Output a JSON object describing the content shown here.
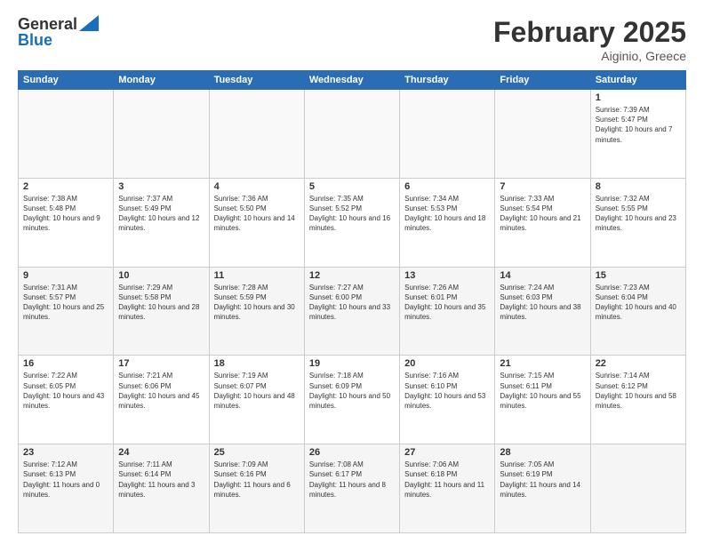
{
  "header": {
    "logo_general": "General",
    "logo_blue": "Blue",
    "month_title": "February 2025",
    "subtitle": "Aiginio, Greece"
  },
  "days_of_week": [
    "Sunday",
    "Monday",
    "Tuesday",
    "Wednesday",
    "Thursday",
    "Friday",
    "Saturday"
  ],
  "weeks": [
    {
      "days": [
        {
          "number": "",
          "info": ""
        },
        {
          "number": "",
          "info": ""
        },
        {
          "number": "",
          "info": ""
        },
        {
          "number": "",
          "info": ""
        },
        {
          "number": "",
          "info": ""
        },
        {
          "number": "",
          "info": ""
        },
        {
          "number": "1",
          "info": "Sunrise: 7:39 AM\nSunset: 5:47 PM\nDaylight: 10 hours and 7 minutes."
        }
      ]
    },
    {
      "days": [
        {
          "number": "2",
          "info": "Sunrise: 7:38 AM\nSunset: 5:48 PM\nDaylight: 10 hours and 9 minutes."
        },
        {
          "number": "3",
          "info": "Sunrise: 7:37 AM\nSunset: 5:49 PM\nDaylight: 10 hours and 12 minutes."
        },
        {
          "number": "4",
          "info": "Sunrise: 7:36 AM\nSunset: 5:50 PM\nDaylight: 10 hours and 14 minutes."
        },
        {
          "number": "5",
          "info": "Sunrise: 7:35 AM\nSunset: 5:52 PM\nDaylight: 10 hours and 16 minutes."
        },
        {
          "number": "6",
          "info": "Sunrise: 7:34 AM\nSunset: 5:53 PM\nDaylight: 10 hours and 18 minutes."
        },
        {
          "number": "7",
          "info": "Sunrise: 7:33 AM\nSunset: 5:54 PM\nDaylight: 10 hours and 21 minutes."
        },
        {
          "number": "8",
          "info": "Sunrise: 7:32 AM\nSunset: 5:55 PM\nDaylight: 10 hours and 23 minutes."
        }
      ]
    },
    {
      "days": [
        {
          "number": "9",
          "info": "Sunrise: 7:31 AM\nSunset: 5:57 PM\nDaylight: 10 hours and 25 minutes."
        },
        {
          "number": "10",
          "info": "Sunrise: 7:29 AM\nSunset: 5:58 PM\nDaylight: 10 hours and 28 minutes."
        },
        {
          "number": "11",
          "info": "Sunrise: 7:28 AM\nSunset: 5:59 PM\nDaylight: 10 hours and 30 minutes."
        },
        {
          "number": "12",
          "info": "Sunrise: 7:27 AM\nSunset: 6:00 PM\nDaylight: 10 hours and 33 minutes."
        },
        {
          "number": "13",
          "info": "Sunrise: 7:26 AM\nSunset: 6:01 PM\nDaylight: 10 hours and 35 minutes."
        },
        {
          "number": "14",
          "info": "Sunrise: 7:24 AM\nSunset: 6:03 PM\nDaylight: 10 hours and 38 minutes."
        },
        {
          "number": "15",
          "info": "Sunrise: 7:23 AM\nSunset: 6:04 PM\nDaylight: 10 hours and 40 minutes."
        }
      ]
    },
    {
      "days": [
        {
          "number": "16",
          "info": "Sunrise: 7:22 AM\nSunset: 6:05 PM\nDaylight: 10 hours and 43 minutes."
        },
        {
          "number": "17",
          "info": "Sunrise: 7:21 AM\nSunset: 6:06 PM\nDaylight: 10 hours and 45 minutes."
        },
        {
          "number": "18",
          "info": "Sunrise: 7:19 AM\nSunset: 6:07 PM\nDaylight: 10 hours and 48 minutes."
        },
        {
          "number": "19",
          "info": "Sunrise: 7:18 AM\nSunset: 6:09 PM\nDaylight: 10 hours and 50 minutes."
        },
        {
          "number": "20",
          "info": "Sunrise: 7:16 AM\nSunset: 6:10 PM\nDaylight: 10 hours and 53 minutes."
        },
        {
          "number": "21",
          "info": "Sunrise: 7:15 AM\nSunset: 6:11 PM\nDaylight: 10 hours and 55 minutes."
        },
        {
          "number": "22",
          "info": "Sunrise: 7:14 AM\nSunset: 6:12 PM\nDaylight: 10 hours and 58 minutes."
        }
      ]
    },
    {
      "days": [
        {
          "number": "23",
          "info": "Sunrise: 7:12 AM\nSunset: 6:13 PM\nDaylight: 11 hours and 0 minutes."
        },
        {
          "number": "24",
          "info": "Sunrise: 7:11 AM\nSunset: 6:14 PM\nDaylight: 11 hours and 3 minutes."
        },
        {
          "number": "25",
          "info": "Sunrise: 7:09 AM\nSunset: 6:16 PM\nDaylight: 11 hours and 6 minutes."
        },
        {
          "number": "26",
          "info": "Sunrise: 7:08 AM\nSunset: 6:17 PM\nDaylight: 11 hours and 8 minutes."
        },
        {
          "number": "27",
          "info": "Sunrise: 7:06 AM\nSunset: 6:18 PM\nDaylight: 11 hours and 11 minutes."
        },
        {
          "number": "28",
          "info": "Sunrise: 7:05 AM\nSunset: 6:19 PM\nDaylight: 11 hours and 14 minutes."
        },
        {
          "number": "",
          "info": ""
        }
      ]
    }
  ]
}
